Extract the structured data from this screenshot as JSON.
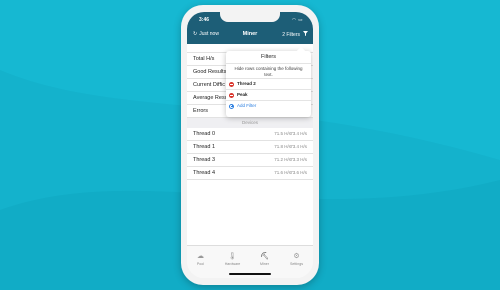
{
  "status_bar": {
    "time": "3:46"
  },
  "nav": {
    "refresh_label": "Just now",
    "title": "Miner",
    "filters_label": "2 Filters"
  },
  "stats": [
    {
      "label": "Total H/s"
    },
    {
      "label": "Good Results"
    },
    {
      "label": "Current Diffic"
    },
    {
      "label": "Average Resu"
    },
    {
      "label": "Errors"
    }
  ],
  "devices_header": "Devices",
  "threads": [
    {
      "name": "Thread 0",
      "v1": "71.5 H/s",
      "v2": "73.4 H/s"
    },
    {
      "name": "Thread 1",
      "v1": "71.8 H/s",
      "v2": "73.4 H/s"
    },
    {
      "name": "Thread 3",
      "v1": "71.2 H/s",
      "v2": "73.3 H/s"
    },
    {
      "name": "Thread 4",
      "v1": "71.6 H/s",
      "v2": "73.6 H/s"
    }
  ],
  "popover": {
    "title": "Filters",
    "description": "Hide rows containing the following text.",
    "filters": [
      {
        "text": "Thread 2"
      },
      {
        "text": "Peak"
      }
    ],
    "add_label": "Add Filter"
  },
  "tabs": [
    {
      "label": "Pool",
      "icon": "cloud-icon"
    },
    {
      "label": "Hardware",
      "icon": "thermometer-icon"
    },
    {
      "label": "Miner",
      "icon": "pickaxe-icon"
    },
    {
      "label": "Settings",
      "icon": "gear-icon"
    }
  ],
  "colors": {
    "background": "#14b2cc",
    "header": "#1d5e77",
    "accent": "#2a7ee0",
    "delete": "#d9342b"
  }
}
